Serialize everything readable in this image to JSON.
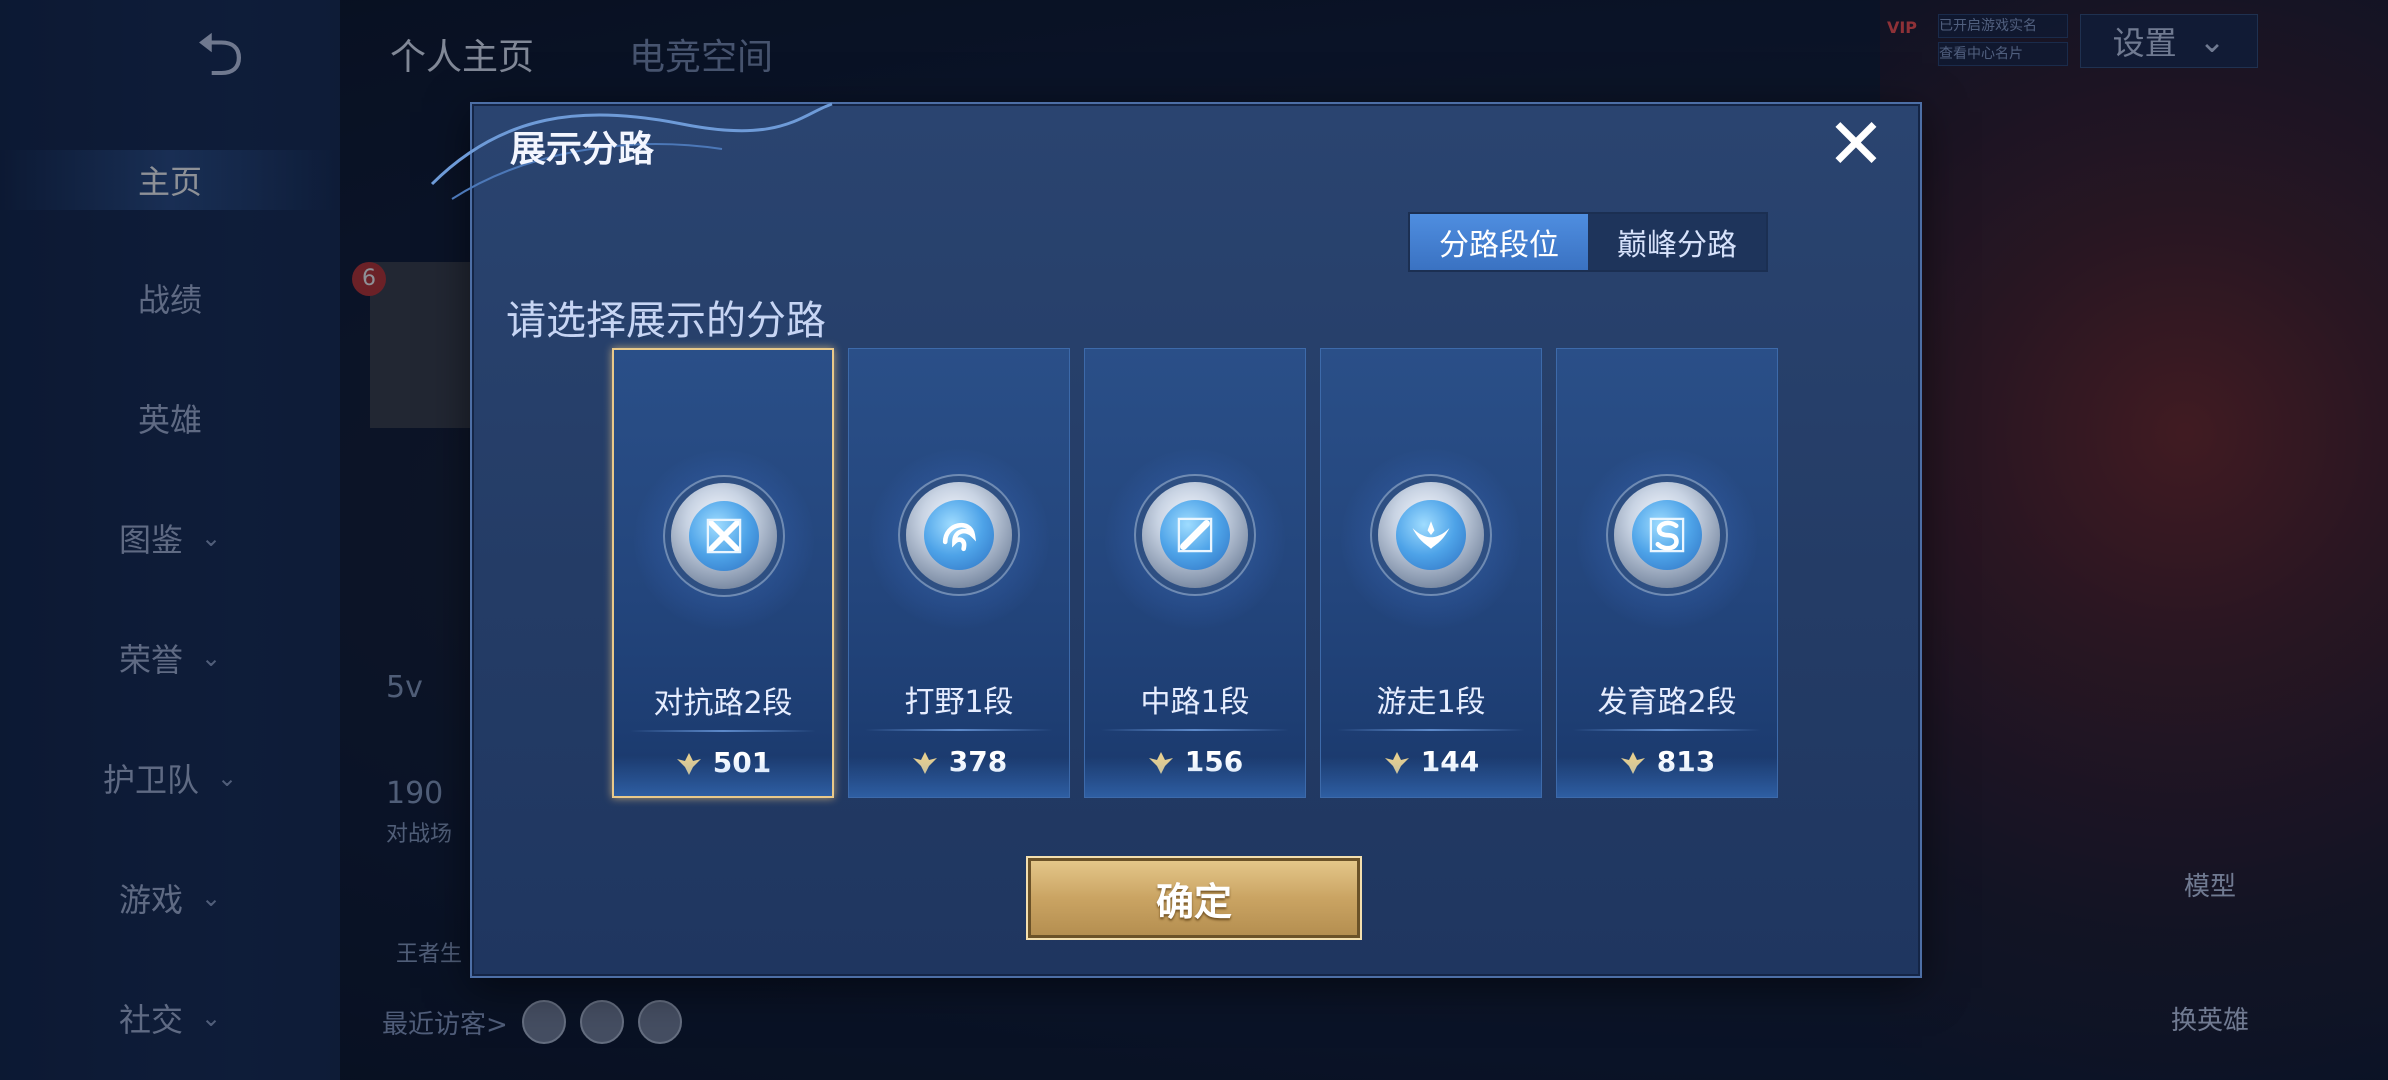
{
  "background": {
    "sidebar_items": [
      {
        "label": "主页",
        "active": true,
        "chevron": false
      },
      {
        "label": "战绩",
        "active": false,
        "chevron": false
      },
      {
        "label": "英雄",
        "active": false,
        "chevron": false
      },
      {
        "label": "图鉴",
        "active": false,
        "chevron": true
      },
      {
        "label": "荣誉",
        "active": false,
        "chevron": true
      },
      {
        "label": "护卫队",
        "active": false,
        "chevron": true
      },
      {
        "label": "游戏",
        "active": false,
        "chevron": true
      },
      {
        "label": "社交",
        "active": false,
        "chevron": true
      }
    ],
    "top_tabs": [
      "个人主页",
      "电竞空间"
    ],
    "settings_label": "设置",
    "vip_label": "VIP",
    "notice_1": "已开启游戏实名",
    "notice_2": "查看中心名片",
    "model_label": "模型",
    "change_hero_label": "换英雄",
    "recent_visitors_label": "最近访客>",
    "badge_count": "6",
    "mini_stat_1": "5v",
    "mini_stat_2": "190",
    "mini_stat_3": "对战场",
    "mini_stat_4": "王者生"
  },
  "dialog": {
    "title": "展示分路",
    "close_icon": "close-icon",
    "segment_tabs": [
      {
        "label": "分路段位",
        "active": true
      },
      {
        "label": "巅峰分路",
        "active": false
      }
    ],
    "prompt": "请选择展示的分路",
    "cards": [
      {
        "label": "对抗路2段",
        "score": "501",
        "selected": true,
        "icon": "clash-lane-icon"
      },
      {
        "label": "打野1段",
        "score": "378",
        "selected": false,
        "icon": "jungle-icon"
      },
      {
        "label": "中路1段",
        "score": "156",
        "selected": false,
        "icon": "mid-lane-icon"
      },
      {
        "label": "游走1段",
        "score": "144",
        "selected": false,
        "icon": "roam-icon"
      },
      {
        "label": "发育路2段",
        "score": "813",
        "selected": false,
        "icon": "farm-lane-icon"
      }
    ],
    "confirm_label": "确定",
    "colors": {
      "accent": "#4f8ee0",
      "selected_border": "#e9c98a",
      "confirm_gold": "#caa463"
    }
  }
}
